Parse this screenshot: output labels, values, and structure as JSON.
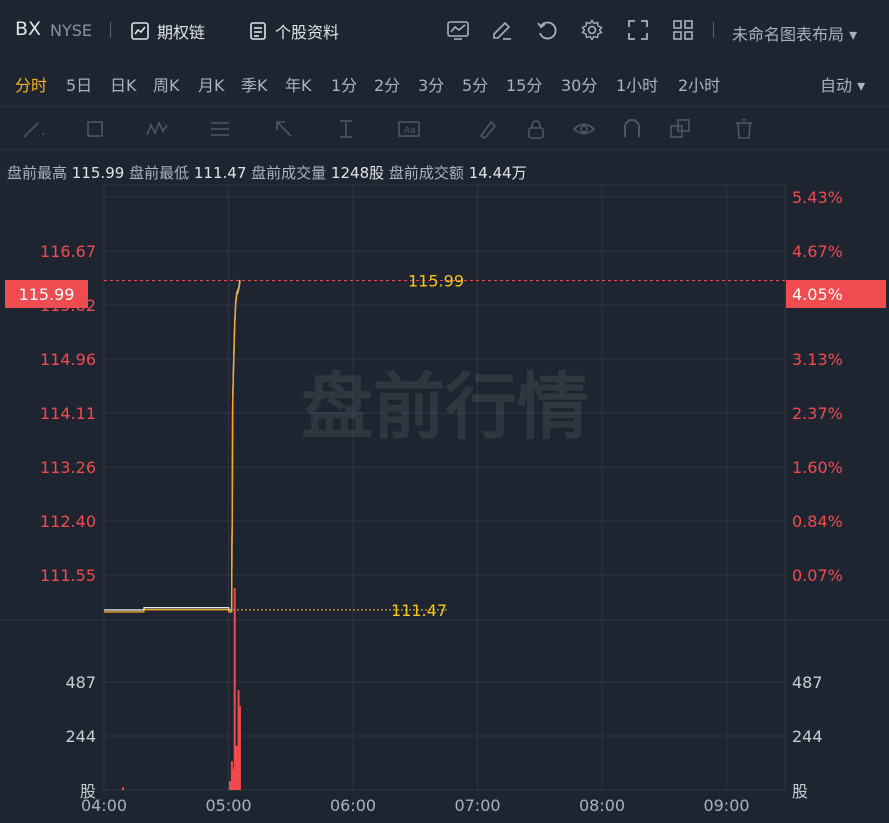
{
  "header": {
    "ticker": "BX",
    "exchange": "NYSE",
    "options_chain": "期权链",
    "stock_profile": "个股资料",
    "layout_name": "未命名图表布局"
  },
  "periods": [
    "分时",
    "5日",
    "日K",
    "周K",
    "月K",
    "季K",
    "年K",
    "1分",
    "2分",
    "3分",
    "5分",
    "15分",
    "30分",
    "1小时",
    "2小时"
  ],
  "active_period": "分时",
  "auto_label": "自动",
  "premarket": {
    "high_label": "盘前最高",
    "high": "115.99",
    "low_label": "盘前最低",
    "low": "111.47",
    "volume_label": "盘前成交量",
    "volume": "1248股",
    "amount_label": "盘前成交额",
    "amount": "14.44万"
  },
  "watermark": "盘前行情",
  "colors": {
    "up": "#f04b4e",
    "price_line": "#f5a623",
    "avg_line": "#e6e6e6",
    "label_yellow": "#f5c518",
    "grid": "#2d3541"
  },
  "chart_data": {
    "type": "line",
    "x_ticks": [
      "04:00",
      "05:00",
      "06:00",
      "07:00",
      "08:00",
      "09:00"
    ],
    "y_left_ticks": [
      "116.67",
      "115.82",
      "114.96",
      "114.11",
      "113.26",
      "112.40",
      "111.55"
    ],
    "y_right_ticks": [
      "5.43%",
      "4.67%",
      "3.13%",
      "2.37%",
      "1.60%",
      "0.84%",
      "0.07%"
    ],
    "current_price": "115.99",
    "current_pct": "4.05%",
    "high_label": "115.99",
    "low_label": "111.47",
    "ylim": [
      111.4,
      117.3
    ],
    "xlim": [
      0,
      330
    ],
    "price_series": [
      [
        0,
        111.47
      ],
      [
        115,
        111.47
      ],
      [
        116,
        111.5
      ],
      [
        360,
        111.5
      ],
      [
        361,
        111.47
      ],
      [
        369,
        111.47
      ],
      [
        370,
        112.4
      ],
      [
        371,
        112.8
      ],
      [
        372,
        114.3
      ],
      [
        375,
        114.9
      ],
      [
        378,
        115.4
      ],
      [
        381,
        115.7
      ],
      [
        384,
        115.82
      ],
      [
        387,
        115.85
      ],
      [
        390,
        115.9
      ],
      [
        393,
        115.99
      ],
      [
        394,
        115.99
      ]
    ],
    "price_series_note": "",
    "volume": {
      "y_ticks": [
        "487",
        "244"
      ],
      "unit": "股",
      "bars": [
        [
          55,
          12
        ],
        [
          364,
          40
        ],
        [
          366,
          25
        ],
        [
          370,
          130
        ],
        [
          372,
          70
        ],
        [
          375,
          95
        ],
        [
          378,
          910
        ],
        [
          380,
          60
        ],
        [
          383,
          200
        ],
        [
          386,
          120
        ],
        [
          389,
          450
        ],
        [
          391,
          80
        ],
        [
          393,
          380
        ]
      ]
    }
  }
}
